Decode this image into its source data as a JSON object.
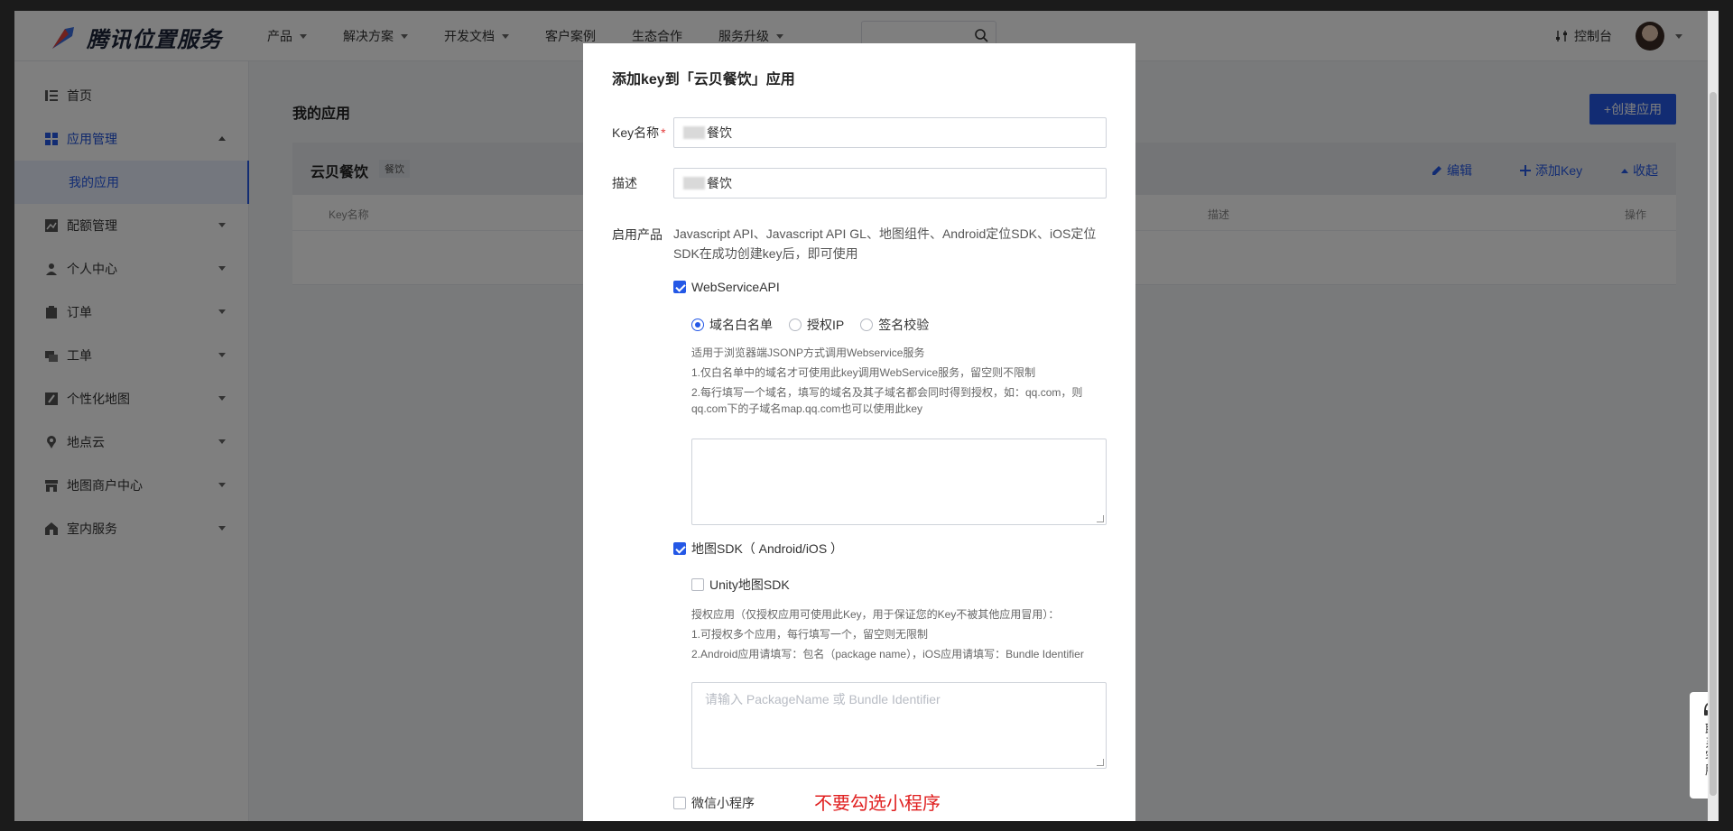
{
  "brand": {
    "name": "腾讯位置服务"
  },
  "nav": {
    "items": [
      {
        "label": "产品",
        "dropdown": true
      },
      {
        "label": "解决方案",
        "dropdown": true
      },
      {
        "label": "开发文档",
        "dropdown": true
      },
      {
        "label": "客户案例",
        "dropdown": false
      },
      {
        "label": "生态合作",
        "dropdown": false
      },
      {
        "label": "服务升级",
        "dropdown": true
      }
    ],
    "console_label": "控制台"
  },
  "sidebar": {
    "items": [
      {
        "label": "首页",
        "icon": "list-icon"
      },
      {
        "label": "应用管理",
        "icon": "grid-icon",
        "active": true
      },
      {
        "label": "配额管理",
        "icon": "chart-icon"
      },
      {
        "label": "个人中心",
        "icon": "user-icon"
      },
      {
        "label": "订单",
        "icon": "clipboard-icon"
      },
      {
        "label": "工单",
        "icon": "ticket-icon"
      },
      {
        "label": "个性化地图",
        "icon": "paint-icon"
      },
      {
        "label": "地点云",
        "icon": "pin-icon"
      },
      {
        "label": "地图商户中心",
        "icon": "store-icon"
      },
      {
        "label": "室内服务",
        "icon": "building-icon"
      }
    ],
    "sub_item": "我的应用"
  },
  "main": {
    "title": "我的应用",
    "create_button": "+创建应用",
    "app": {
      "name": "云贝餐饮",
      "tag": "餐饮",
      "actions": [
        "编辑",
        "添加Key",
        "收起"
      ]
    },
    "table_headers": [
      "Key名称",
      "描述",
      "操作"
    ]
  },
  "modal": {
    "title": "添加key到「云贝餐饮」应用",
    "key_name_label": "Key名称",
    "key_name_value": "餐饮",
    "desc_label": "描述",
    "desc_value": "餐饮",
    "products_label": "启用产品",
    "products_desc": "Javascript API、Javascript API GL、地图组件、Android定位SDK、iOS定位SDK在成功创建key后，即可使用",
    "webservice": {
      "label": "WebServiceAPI",
      "checked": true,
      "radios": [
        "域名白名单",
        "授权IP",
        "签名校验"
      ],
      "selected": "域名白名单",
      "hints": [
        "适用于浏览器端JSONP方式调用Webservice服务",
        "1.仅白名单中的域名才可使用此key调用WebService服务，留空则不限制",
        "2.每行填写一个域名，填写的域名及其子域名都会同时得到授权，如：qq.com，则qq.com下的子域名map.qq.com也可以使用此key"
      ]
    },
    "sdk": {
      "label": "地图SDK（ Android/iOS ）",
      "checked": true,
      "unity_label": "Unity地图SDK",
      "unity_checked": false,
      "hints": [
        "授权应用（仅授权应用可使用此Key，用于保证您的Key不被其他应用冒用）：",
        "1.可授权多个应用，每行填写一个，留空则无限制",
        "2.Android应用请填写：包名（package name），iOS应用请填写：Bundle Identifier"
      ],
      "placeholder": "请输入 PackageName 或 Bundle Identifier"
    },
    "miniprogram": {
      "label": "微信小程序",
      "checked": false
    },
    "warning": "不要勾选小程序"
  },
  "service_float": {
    "label": "联系客服"
  },
  "colors": {
    "primary": "#2458e6",
    "warning": "#e02020"
  }
}
